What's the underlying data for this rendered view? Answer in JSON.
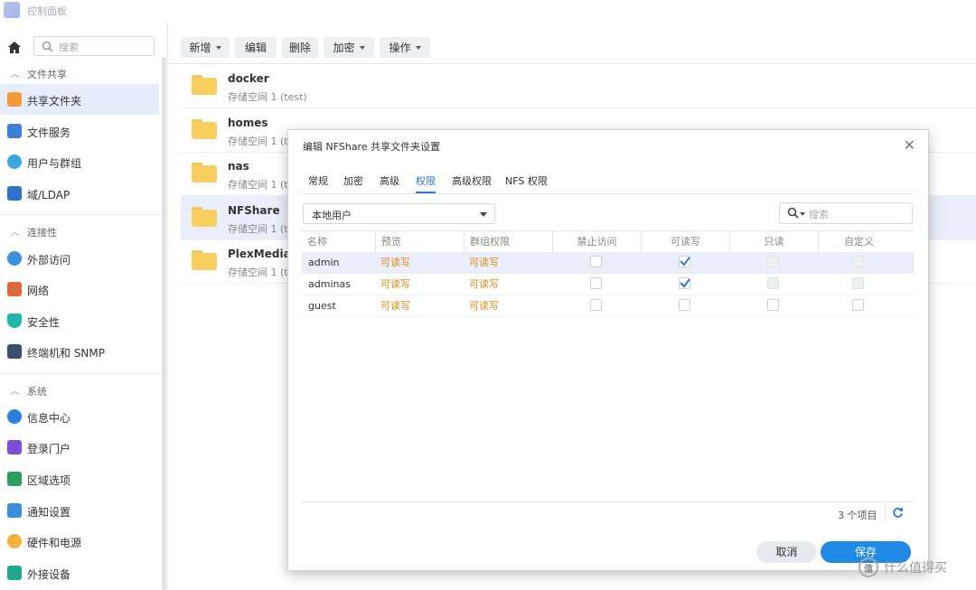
{
  "window": {
    "title": "控制面板"
  },
  "sidebar": {
    "search_placeholder": "搜索",
    "sections": [
      {
        "label": "文件共享"
      },
      {
        "label": "连接性"
      },
      {
        "label": "系统"
      }
    ],
    "items": [
      {
        "label": "共享文件夹",
        "icon": "shared-folder-icon",
        "color": "#f29a38",
        "active": true
      },
      {
        "label": "文件服务",
        "icon": "file-services-icon",
        "color": "#3a7fd9"
      },
      {
        "label": "用户与群组",
        "icon": "users-icon",
        "color": "#3ba6e0"
      },
      {
        "label": "域/LDAP",
        "icon": "domain-icon",
        "color": "#2f73c8"
      },
      {
        "label": "外部访问",
        "icon": "external-access-icon",
        "color": "#3d8fe0"
      },
      {
        "label": "网络",
        "icon": "network-icon",
        "color": "#e06a3b"
      },
      {
        "label": "安全性",
        "icon": "security-icon",
        "color": "#21b4a8"
      },
      {
        "label": "终端机和 SNMP",
        "icon": "terminal-icon",
        "color": "#3a4f6f"
      },
      {
        "label": "信息中心",
        "icon": "info-icon",
        "color": "#2f7de0"
      },
      {
        "label": "登录门户",
        "icon": "login-portal-icon",
        "color": "#7a4fd6"
      },
      {
        "label": "区域选项",
        "icon": "region-icon",
        "color": "#2aa05a"
      },
      {
        "label": "通知设置",
        "icon": "notification-icon",
        "color": "#3b8fe0"
      },
      {
        "label": "硬件和电源",
        "icon": "hardware-icon",
        "color": "#f2b13a"
      },
      {
        "label": "外接设备",
        "icon": "external-devices-icon",
        "color": "#1faa8f"
      }
    ]
  },
  "toolbar": {
    "create": "新增",
    "edit": "编辑",
    "delete": "删除",
    "encrypt": "加密",
    "action": "操作"
  },
  "folders": [
    {
      "name": "docker",
      "sub": "存储空间 1 (test)"
    },
    {
      "name": "homes",
      "sub": "存储空间 1 (t"
    },
    {
      "name": "nas",
      "sub": "存储空间 1 (t"
    },
    {
      "name": "NFShare",
      "sub": "存储空间 1 (t",
      "selected": true
    },
    {
      "name": "PlexMediaS",
      "sub": "存储空间 1 (t"
    }
  ],
  "dialog": {
    "title": "编辑 NFShare 共享文件夹设置",
    "tabs": [
      "常规",
      "加密",
      "高级",
      "权限",
      "高级权限",
      "NFS 权限"
    ],
    "active_tab": 3,
    "user_type": "本地用户",
    "search_placeholder": "搜索",
    "columns": [
      "名称",
      "预览",
      "群组权限",
      "禁止访问",
      "可读写",
      "只读",
      "自定义"
    ],
    "rows": [
      {
        "name": "admin",
        "preview": "可读写",
        "group": "可读写",
        "deny": false,
        "rw": true,
        "ro": false,
        "custom": false,
        "selected": true
      },
      {
        "name": "adminas",
        "preview": "可读写",
        "group": "可读写",
        "deny": false,
        "rw": true,
        "ro": false,
        "custom": false
      },
      {
        "name": "guest",
        "preview": "可读写",
        "group": "可读写",
        "deny": false,
        "rw": false,
        "ro": false,
        "custom": false
      }
    ],
    "item_count": "3 个项目",
    "cancel": "取消",
    "save": "保存"
  },
  "watermark": {
    "text": "什么值得买",
    "logo": "值"
  }
}
